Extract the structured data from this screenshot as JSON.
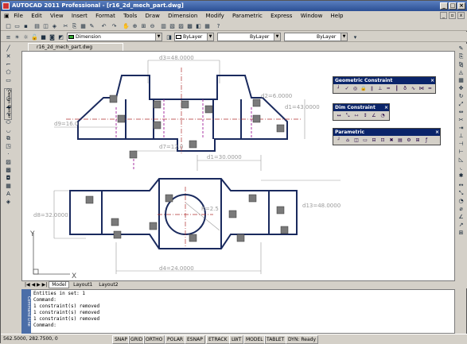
{
  "window": {
    "title": "AUTOCAD 2011 Professional - [r16_2d_mech_part.dwg]",
    "minimize": "_",
    "maximize": "□",
    "close": "×"
  },
  "menu": [
    "File",
    "Edit",
    "View",
    "Insert",
    "Format",
    "Tools",
    "Draw",
    "Dimension",
    "Modify",
    "Parametric",
    "Express",
    "Window",
    "Help"
  ],
  "toolbar": {
    "dimstyle": "Dimension",
    "layer": "ByLayer",
    "linetype": "ByLayer",
    "lineweight": "ByLayer",
    "color_layer": "ByLayer"
  },
  "document_tab": "r16_2d_mech_part.dwg",
  "palette_tab": "Design Center",
  "dimensions": {
    "d3": "d3=48.0000",
    "d2": "d2=6.0000",
    "d1": "d1=43.0000",
    "d9": "d9=16.0",
    "d7": "d7=12.0",
    "d1b": "d1=30.0000",
    "d8": "d8=32.0000",
    "d13": "d13=48.0000",
    "d5": "R=2.5",
    "d4": "d4=24.0000"
  },
  "ucs": {
    "x": "X",
    "y": "Y"
  },
  "panels": {
    "geometric": "Geometric Constraint",
    "dimensional": "Dim Constraint",
    "parametric": "Parametric"
  },
  "layout_tabs": [
    "Model",
    "Layout1",
    "Layout2"
  ],
  "command_lines": [
    "Entities in set: 1",
    "Command:",
    "1 constraint(s) removed",
    "1 constraint(s) removed",
    "1 constraint(s) removed",
    "Command:"
  ],
  "command_side": "Command Line",
  "status": {
    "coords": "562.5000, 282.7500, 0",
    "buttons": [
      "SNAP",
      "GRID",
      "ORTHO",
      "POLAR",
      "ESNAP",
      "ETRACK",
      "LWT",
      "MODEL",
      "TABLET",
      "DYN: Ready"
    ]
  },
  "colors": {
    "part": "#1a2a5e",
    "dim": "#9a9a9a",
    "center": "#b03030",
    "hidden": "#a0209a",
    "title": "#2b4f94"
  }
}
